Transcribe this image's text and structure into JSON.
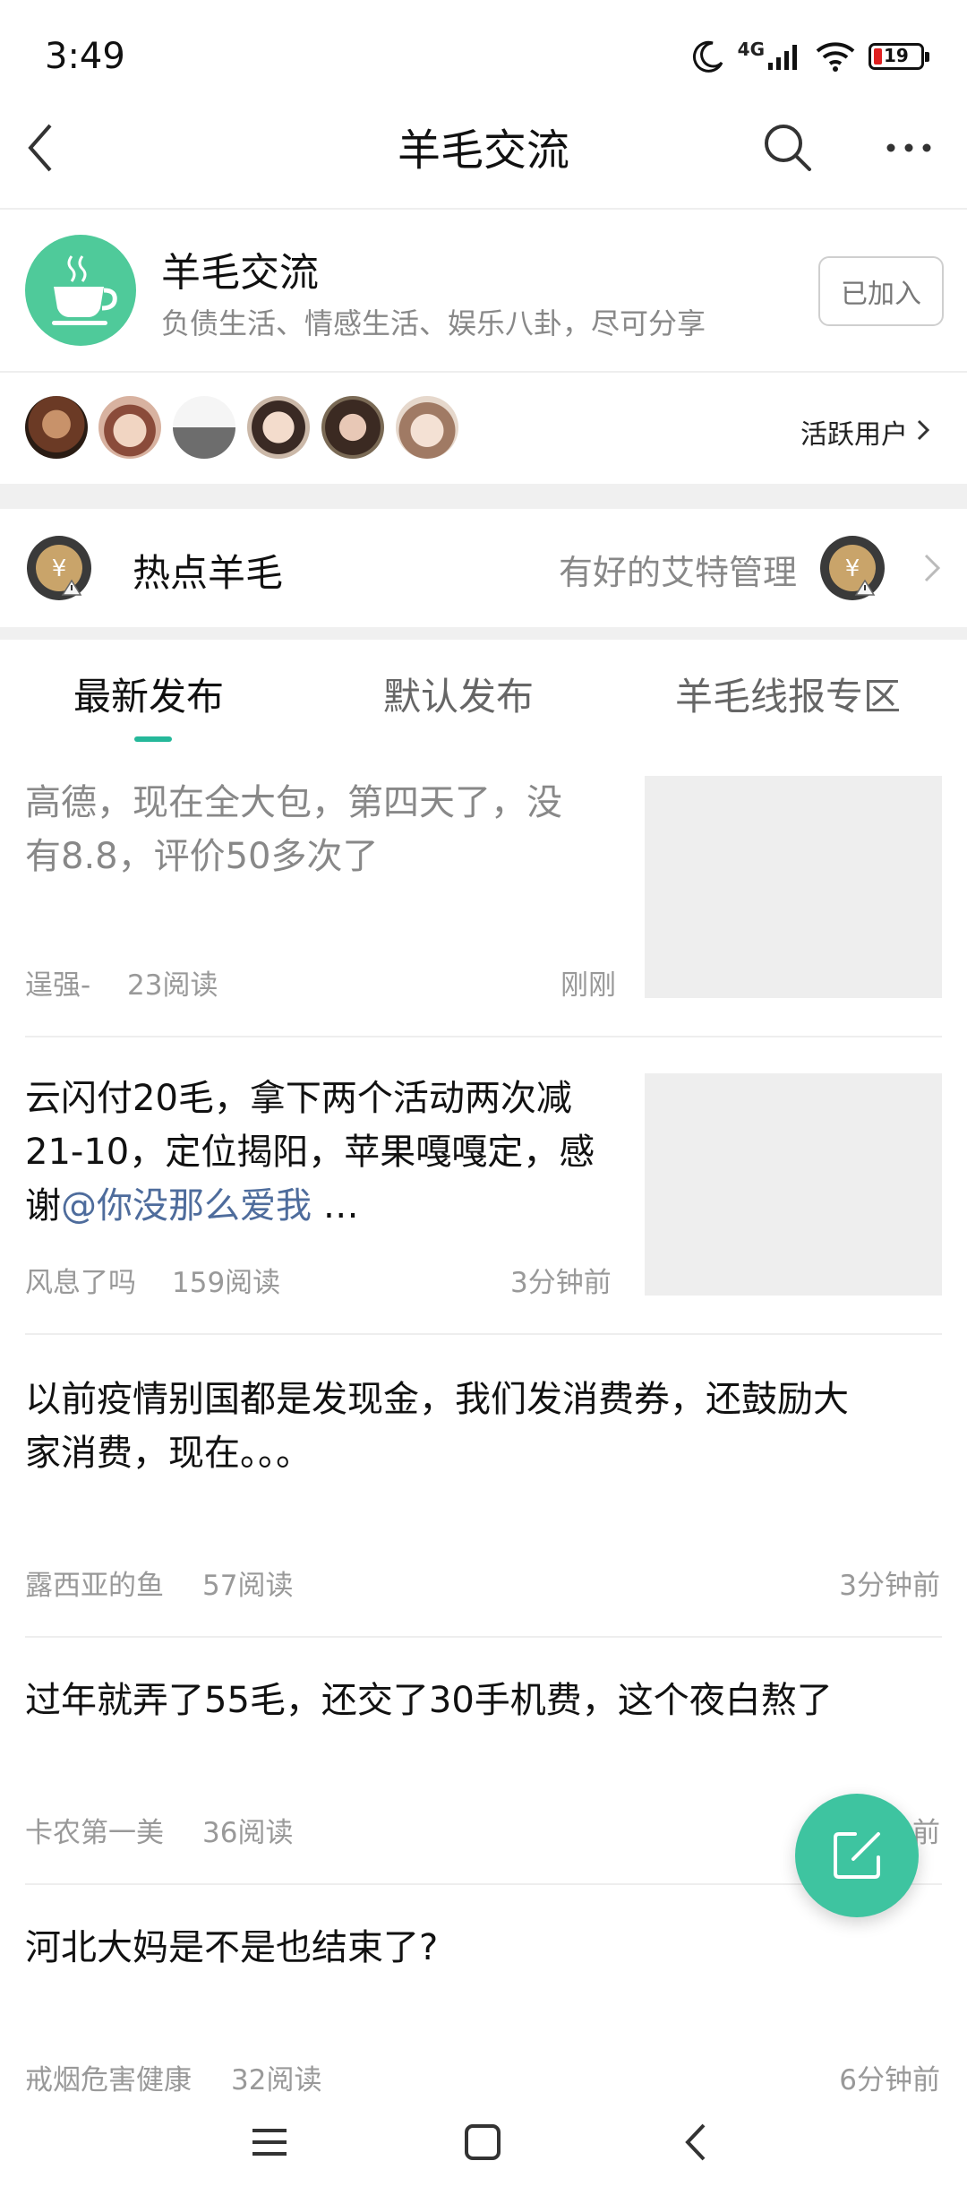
{
  "status_bar": {
    "time": "3:49",
    "network": "4G",
    "battery": "19",
    "icons": [
      "moon-icon",
      "signal-icon",
      "wifi-icon",
      "battery-icon"
    ]
  },
  "nav": {
    "title": "羊毛交流",
    "icons": [
      "back-icon",
      "search-icon",
      "more-icon"
    ]
  },
  "group": {
    "name": "羊毛交流",
    "description": "负债生活、情感生活、娱乐八卦，尽可分享",
    "join_label": "已加入",
    "logo_icon": "coffee-cup-icon",
    "logo_color": "#4fca9a"
  },
  "active_users": {
    "label": "活跃用户",
    "count_shown": 6
  },
  "hot": {
    "title": "热点羊毛",
    "manager_text": "有好的艾特管理"
  },
  "tabs": [
    {
      "label": "最新发布",
      "active": true
    },
    {
      "label": "默认发布",
      "active": false
    },
    {
      "label": "羊毛线报专区",
      "active": false
    }
  ],
  "posts": [
    {
      "title_line1": "高德，现在全大包，第四天了，没",
      "title_line2": "有8.8，评价50多次了",
      "author": "逞强-",
      "reads": "23阅读",
      "time": "刚刚",
      "has_thumb": true,
      "read": true
    },
    {
      "title_line1": "云闪付20毛，拿下两个活动两次减",
      "title_line2": "21-10，定位揭阳，苹果嘎嘎定，感",
      "title_line3_prefix": "谢",
      "mention": "@你没那么爱我",
      "ellipsis": " …",
      "author": "风息了吗",
      "reads": "159阅读",
      "time": "3分钟前",
      "has_thumb": true
    },
    {
      "title_line1": "以前疫情别国都是发现金，我们发消费券，还鼓励大",
      "title_line2": "家消费，现在。。。",
      "author": "露西亚的鱼",
      "reads": "57阅读",
      "time": "3分钟前"
    },
    {
      "title_line1": "过年就弄了55毛，还交了30手机费，这个夜白熬了",
      "author": "卡农第一美",
      "reads": "36阅读",
      "time": "前"
    },
    {
      "title_line1": "河北大妈是不是也结束了?",
      "author": "戒烟危害健康",
      "reads": "32阅读",
      "time": "6分钟前"
    }
  ],
  "colors": {
    "accent": "#25b89a",
    "fab": "#3ec4a0",
    "mention": "#4e6c9c"
  }
}
